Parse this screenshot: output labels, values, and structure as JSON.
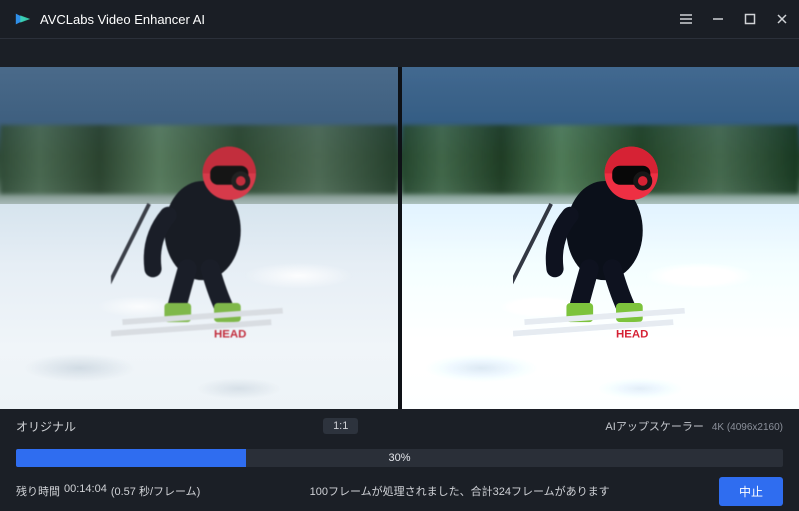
{
  "app": {
    "title": "AVCLabs Video Enhancer AI"
  },
  "preview": {
    "original_label": "オリジナル",
    "ratio": "1:1",
    "upscaler_label": "AIアップスケーラー",
    "output_res": "4K (4096x2160)"
  },
  "progress": {
    "percent_text": "30%",
    "percent_value": 30
  },
  "footer": {
    "remaining_label": "残り時間",
    "remaining_value": "00:14:04",
    "frame_rate": "(0.57 秒/フレーム)",
    "status": "100フレームが処理されました、合計324フレームがあります",
    "stop_label": "中止"
  }
}
